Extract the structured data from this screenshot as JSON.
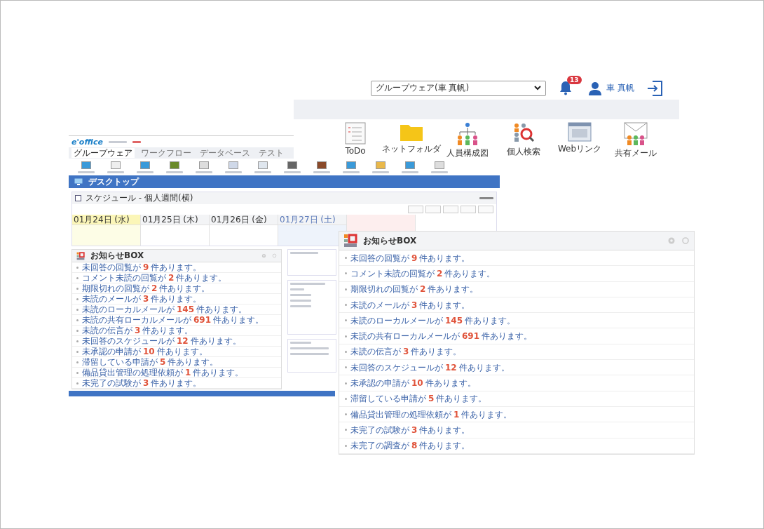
{
  "header": {
    "group_select": "グループウェア(車 真帆)",
    "notification_count": "13",
    "user_name": "車 真帆"
  },
  "apps": [
    {
      "label": "ToDo",
      "kind": "todo"
    },
    {
      "label": "ネットフォルダ",
      "kind": "folder"
    },
    {
      "label": "人員構成図",
      "kind": "org"
    },
    {
      "label": "個人検索",
      "kind": "search"
    },
    {
      "label": "Webリンク",
      "kind": "web"
    },
    {
      "label": "共有メール",
      "kind": "mail"
    }
  ],
  "mini_screen": {
    "logo": "e'office",
    "tabs": [
      {
        "label": "グループウェア",
        "selected": true
      },
      {
        "label": "ワークフロー",
        "selected": false
      },
      {
        "label": "データベース",
        "selected": false
      },
      {
        "label": "テスト",
        "selected": false
      }
    ],
    "desktop_title": "デスクトップ",
    "schedule": {
      "title": "スケジュール - 個人週間(横)",
      "days": [
        {
          "date": "01月24日 (水)",
          "kind": "today"
        },
        {
          "date": "01月25日 (木)",
          "kind": "weekday"
        },
        {
          "date": "01月26日 (金)",
          "kind": "weekday"
        },
        {
          "date": "01月27日 (土)",
          "kind": "saturday"
        }
      ]
    },
    "notice_box": {
      "title": "お知らせBOX",
      "items": [
        {
          "before": "未回答の回覧が",
          "count": "9",
          "after": "件あります。"
        },
        {
          "before": "コメント未読の回覧が",
          "count": "2",
          "after": "件あります。"
        },
        {
          "before": "期限切れの回覧が",
          "count": "2",
          "after": "件あります。"
        },
        {
          "before": "未読のメールが",
          "count": "3",
          "after": "件あります。"
        },
        {
          "before": "未読のローカルメールが",
          "count": "145",
          "after": "件あります。"
        },
        {
          "before": "未読の共有ローカルメールが",
          "count": "691",
          "after": "件あります。"
        },
        {
          "before": "未読の伝言が",
          "count": "3",
          "after": "件あります。"
        },
        {
          "before": "未回答のスケジュールが",
          "count": "12",
          "after": "件あります。"
        },
        {
          "before": "未承認の申請が",
          "count": "10",
          "after": "件あります。"
        },
        {
          "before": "滞留している申請が",
          "count": "5",
          "after": "件あります。"
        },
        {
          "before": "備品貸出管理の処理依頼が",
          "count": "1",
          "after": "件あります。"
        },
        {
          "before": "未完了の試験が",
          "count": "3",
          "after": "件あります。"
        }
      ]
    }
  },
  "notice_box": {
    "title": "お知らせBOX",
    "items": [
      {
        "before": "未回答の回覧が",
        "count": "9",
        "after": "件あります。"
      },
      {
        "before": "コメント未読の回覧が",
        "count": "2",
        "after": "件あります。"
      },
      {
        "before": "期限切れの回覧が",
        "count": "2",
        "after": "件あります。"
      },
      {
        "before": "未読のメールが",
        "count": "3",
        "after": "件あります。"
      },
      {
        "before": "未読のローカルメールが",
        "count": "145",
        "after": "件あります。"
      },
      {
        "before": "未読の共有ローカルメールが",
        "count": "691",
        "after": "件あります。"
      },
      {
        "before": "未読の伝言が",
        "count": "3",
        "after": "件あります。"
      },
      {
        "before": "未回答のスケジュールが",
        "count": "12",
        "after": "件あります。"
      },
      {
        "before": "未承認の申請が",
        "count": "10",
        "after": "件あります。"
      },
      {
        "before": "滞留している申請が",
        "count": "5",
        "after": "件あります。"
      },
      {
        "before": "備品貸出管理の処理依頼が",
        "count": "1",
        "after": "件あります。"
      },
      {
        "before": "未完了の試験が",
        "count": "3",
        "after": "件あります。"
      },
      {
        "before": "未完了の調査が",
        "count": "8",
        "after": "件あります。"
      }
    ]
  }
}
